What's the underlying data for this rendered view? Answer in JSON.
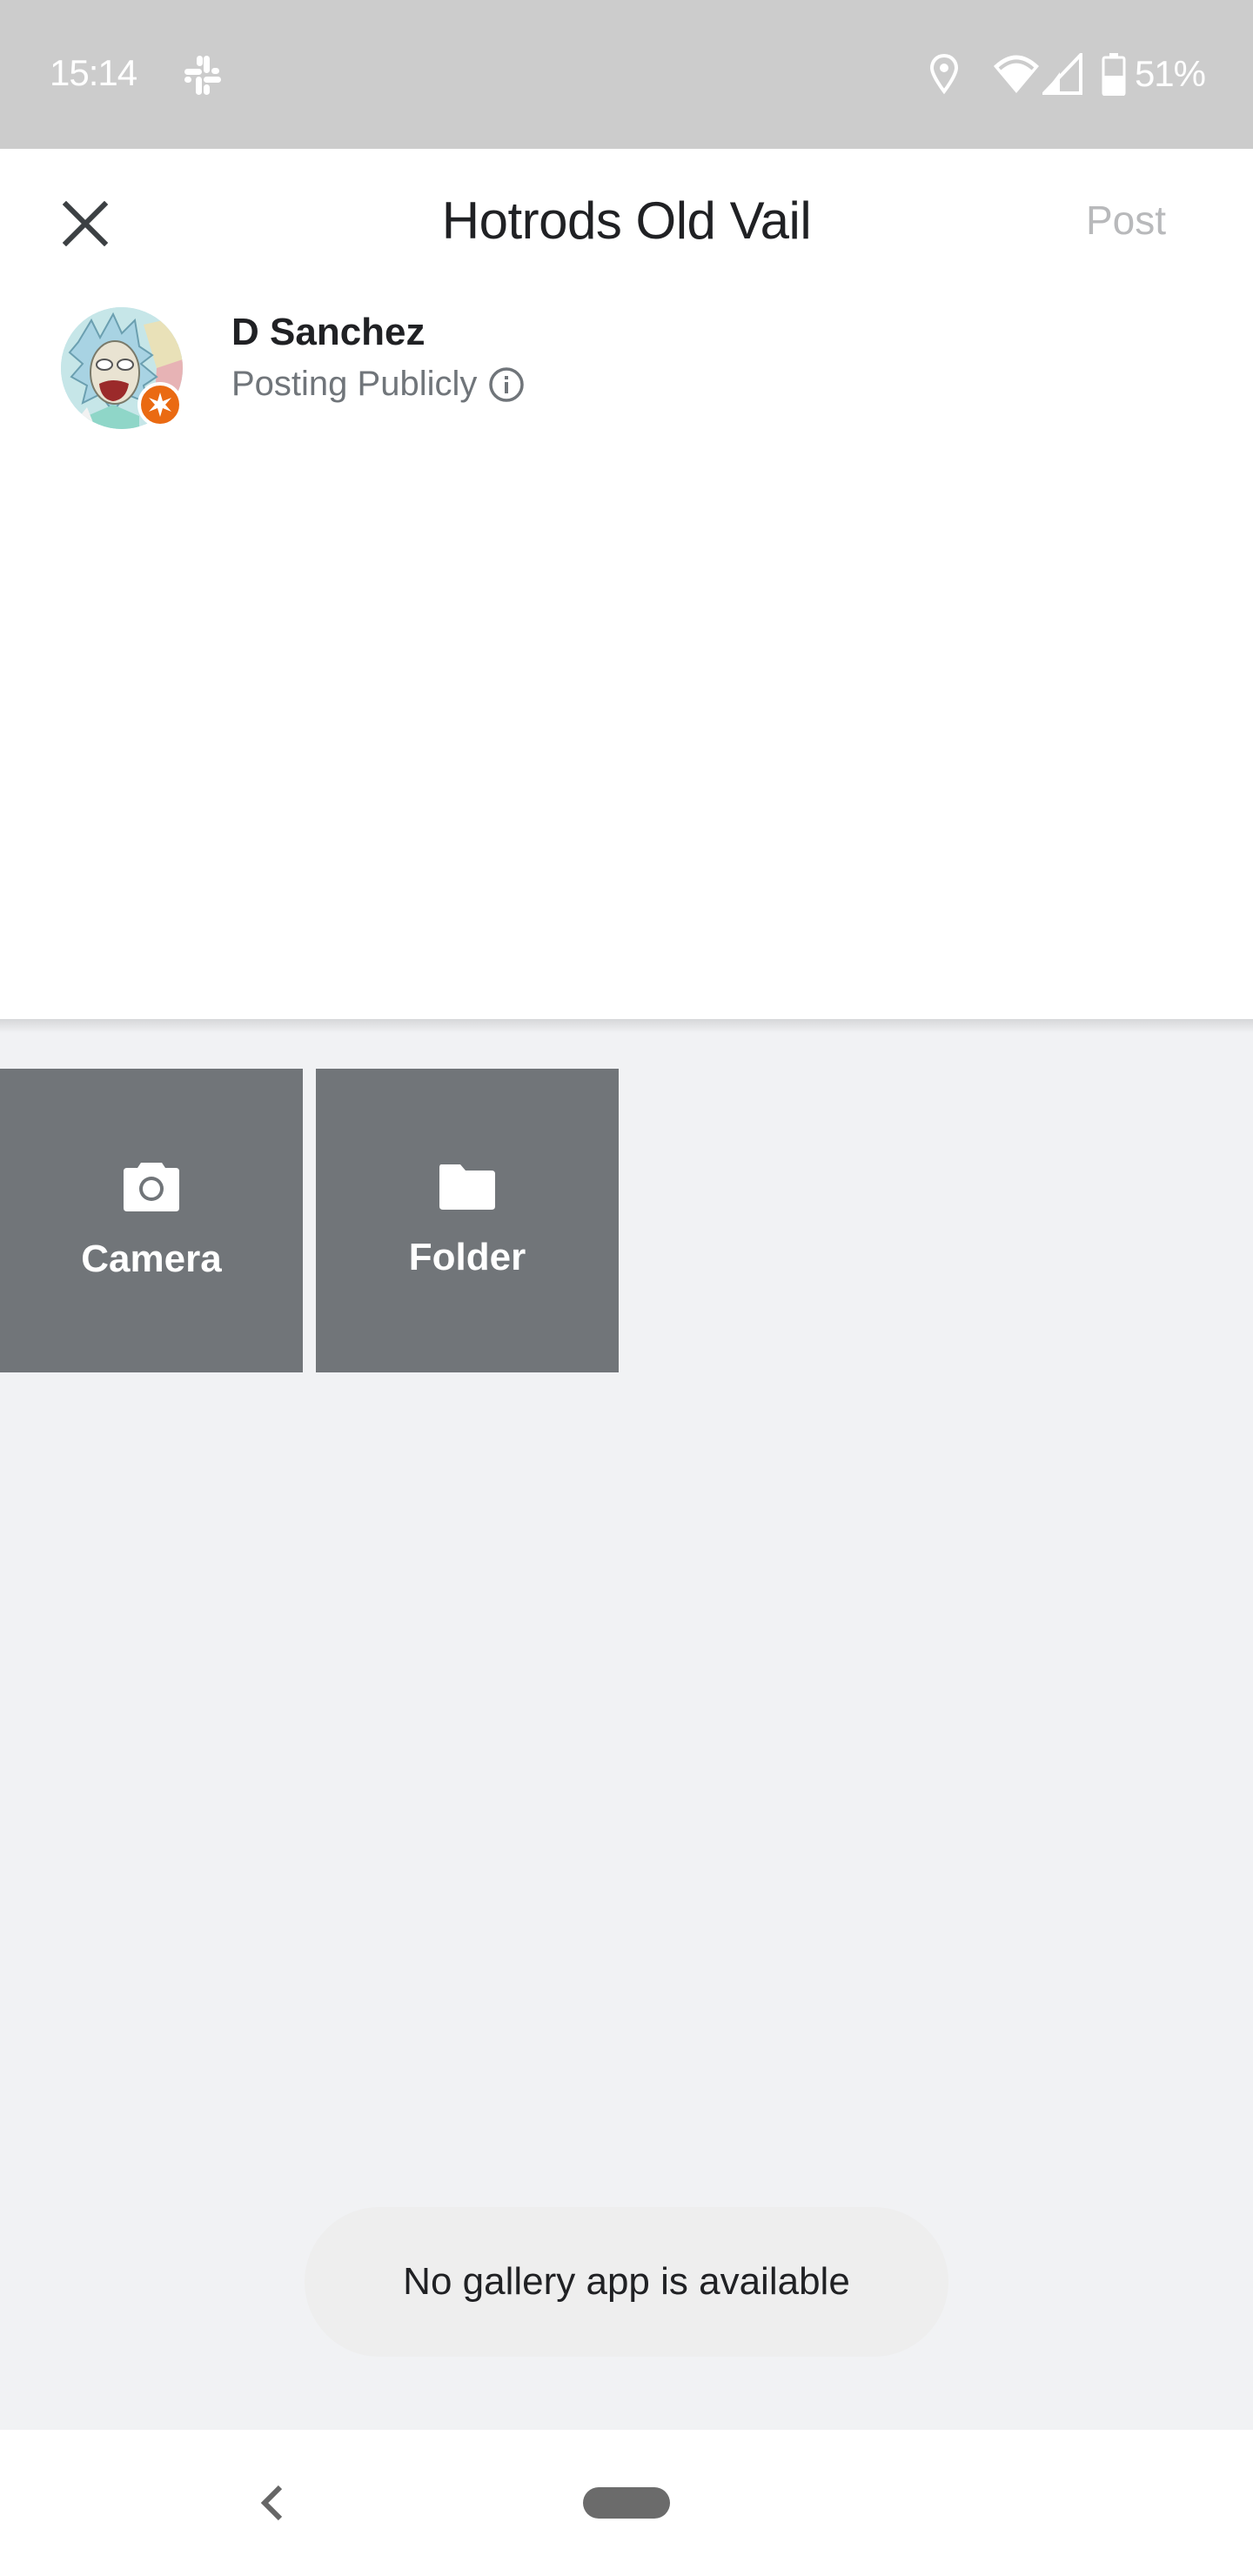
{
  "status_bar": {
    "time": "15:14",
    "notification_icons": [
      "slack-icon"
    ],
    "system_icons": [
      "location-icon",
      "wifi-icon",
      "cell-signal-icon",
      "battery-icon"
    ],
    "battery_percent": "51%"
  },
  "header": {
    "close_icon": "close-icon",
    "title": "Hotrods Old Vail",
    "post_label": "Post"
  },
  "author": {
    "name": "D Sanchez",
    "visibility": "Posting Publicly",
    "info_icon": "info-icon",
    "badge_icon": "star-badge-icon"
  },
  "attachments": [
    {
      "label": "Camera",
      "icon": "camera-icon"
    },
    {
      "label": "Folder",
      "icon": "folder-icon"
    }
  ],
  "toast": {
    "message": "No gallery app is available"
  },
  "nav_bar": {
    "back_icon": "back-chevron-icon",
    "home_icon": "home-pill"
  },
  "colors": {
    "status_bar": "#cccccc",
    "tile": "#717579",
    "background": "#f1f2f4",
    "badge": "#ea6a12",
    "post_disabled": "#b8b9bb"
  }
}
